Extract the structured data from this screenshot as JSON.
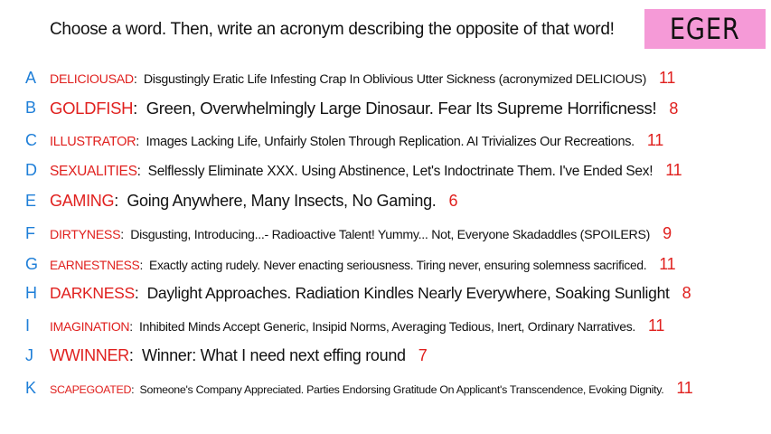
{
  "prompt": "Choose a word. Then, write an acronym describing the opposite of that word!",
  "name_box": {
    "label": "EGER",
    "color": "#f59ad7"
  },
  "colors": {
    "letter": "#1f7fd8",
    "word": "#e0201e",
    "score": "#e0201e",
    "text": "#111111"
  },
  "entries": [
    {
      "letter": "A",
      "word": "DELICIOUSAD",
      "acronym": "Disgustingly Eratic Life Infesting Crap In Oblivious Utter Sickness (acronymized DELICIOUS)",
      "score": "11"
    },
    {
      "letter": "B",
      "word": "GOLDFISH",
      "acronym": "Green, Overwhelmingly Large Dinosaur. Fear Its Supreme Horrificness!",
      "score": "8"
    },
    {
      "letter": "C",
      "word": "ILLUSTRATOR",
      "acronym": "Images Lacking Life, Unfairly Stolen Through Replication. AI Trivializes Our Recreations.",
      "score": "11"
    },
    {
      "letter": "D",
      "word": "SEXUALITIES",
      "acronym": "Selflessly Eliminate XXX. Using Abstinence, Let's Indoctrinate Them. I've Ended Sex!",
      "score": "11"
    },
    {
      "letter": "E",
      "word": "GAMING",
      "acronym": "Going Anywhere, Many Insects, No Gaming.",
      "score": "6"
    },
    {
      "letter": "F",
      "word": "DIRTYNESS",
      "acronym": "Disgusting, Introducing...- Radioactive Talent! Yummy... Not, Everyone Skadaddles (SPOILERS)",
      "score": "9"
    },
    {
      "letter": "G",
      "word": "EARNESTNESS",
      "acronym": "Exactly acting rudely. Never enacting seriousness. Tiring never, ensuring solemness sacrificed.",
      "score": "11"
    },
    {
      "letter": "H",
      "word": "DARKNESS",
      "acronym": "Daylight Approaches. Radiation Kindles Nearly Everywhere, Soaking Sunlight",
      "score": "8"
    },
    {
      "letter": "I",
      "word": "IMAGINATION",
      "acronym": "Inhibited Minds Accept Generic, Insipid Norms, Averaging Tedious, Inert, Ordinary Narratives.",
      "score": "11"
    },
    {
      "letter": "J",
      "word": "WWINNER",
      "acronym": "Winner: What I need next effing round",
      "score": "7"
    },
    {
      "letter": "K",
      "word": "SCAPEGOATED",
      "acronym": "Someone's Company Appreciated. Parties Endorsing Gratitude On Applicant's Transcendence, Evoking Dignity.",
      "score": "11"
    }
  ]
}
